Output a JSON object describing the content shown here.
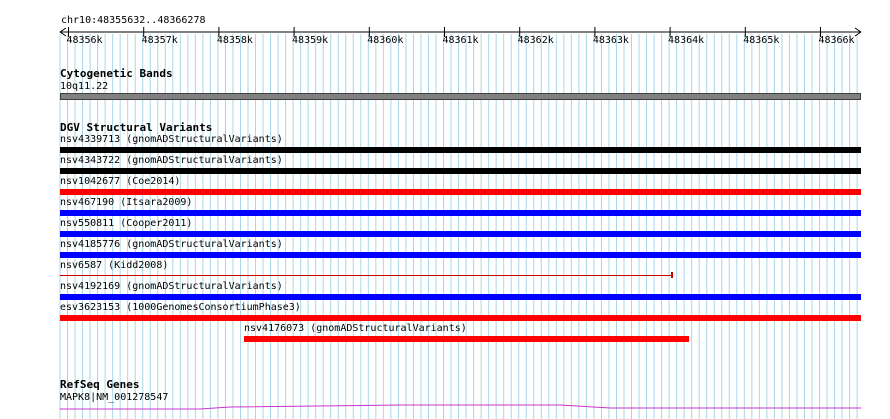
{
  "locus": "chr10:48355632..48366278",
  "ruler": {
    "ticks": [
      "48356k",
      "48357k",
      "48358k",
      "48359k",
      "48360k",
      "48361k",
      "48362k",
      "48363k",
      "48364k",
      "48365k",
      "48366k"
    ]
  },
  "tracks": {
    "cytoband": {
      "title": "Cytogenetic Bands",
      "band_label": "10q11.22",
      "band_color": "#808080"
    },
    "dgv": {
      "title": "DGV Structural Variants",
      "features": [
        {
          "label": "nsv4339713 (gnomADStructuralVariants)",
          "color": "#000000",
          "span": "full"
        },
        {
          "label": "nsv4343722 (gnomADStructuralVariants)",
          "color": "#000000",
          "span": "full"
        },
        {
          "label": "nsv1042677 (Coe2014)",
          "color": "#ff0000",
          "span": "full"
        },
        {
          "label": "nsv467190 (Itsara2009)",
          "color": "#0000ff",
          "span": "full"
        },
        {
          "label": "nsv550811 (Cooper2011)",
          "color": "#0000ff",
          "span": "full"
        },
        {
          "label": "nsv4185776 (gnomADStructuralVariants)",
          "color": "#0000ff",
          "span": "full"
        },
        {
          "label": "nsv6587 (Kidd2008)",
          "color": "#cc0000",
          "span": "partial-thin"
        },
        {
          "label": "nsv4192169 (gnomADStructuralVariants)",
          "color": "#0000ff",
          "span": "full"
        },
        {
          "label": "esv3623153 (1000GenomesConsortiumPhase3)",
          "color": "#ff0000",
          "span": "full"
        },
        {
          "label": "nsv4176073 (gnomADStructuralVariants)",
          "color": "#ff0000",
          "span": "partial"
        }
      ]
    },
    "refseq": {
      "title": "RefSeq Genes",
      "gene_label": "MAPK8|NM_001278547",
      "color": "#cc33cc"
    }
  },
  "colors": {
    "grid": "#a8d8e8",
    "ruler": "#000000"
  }
}
